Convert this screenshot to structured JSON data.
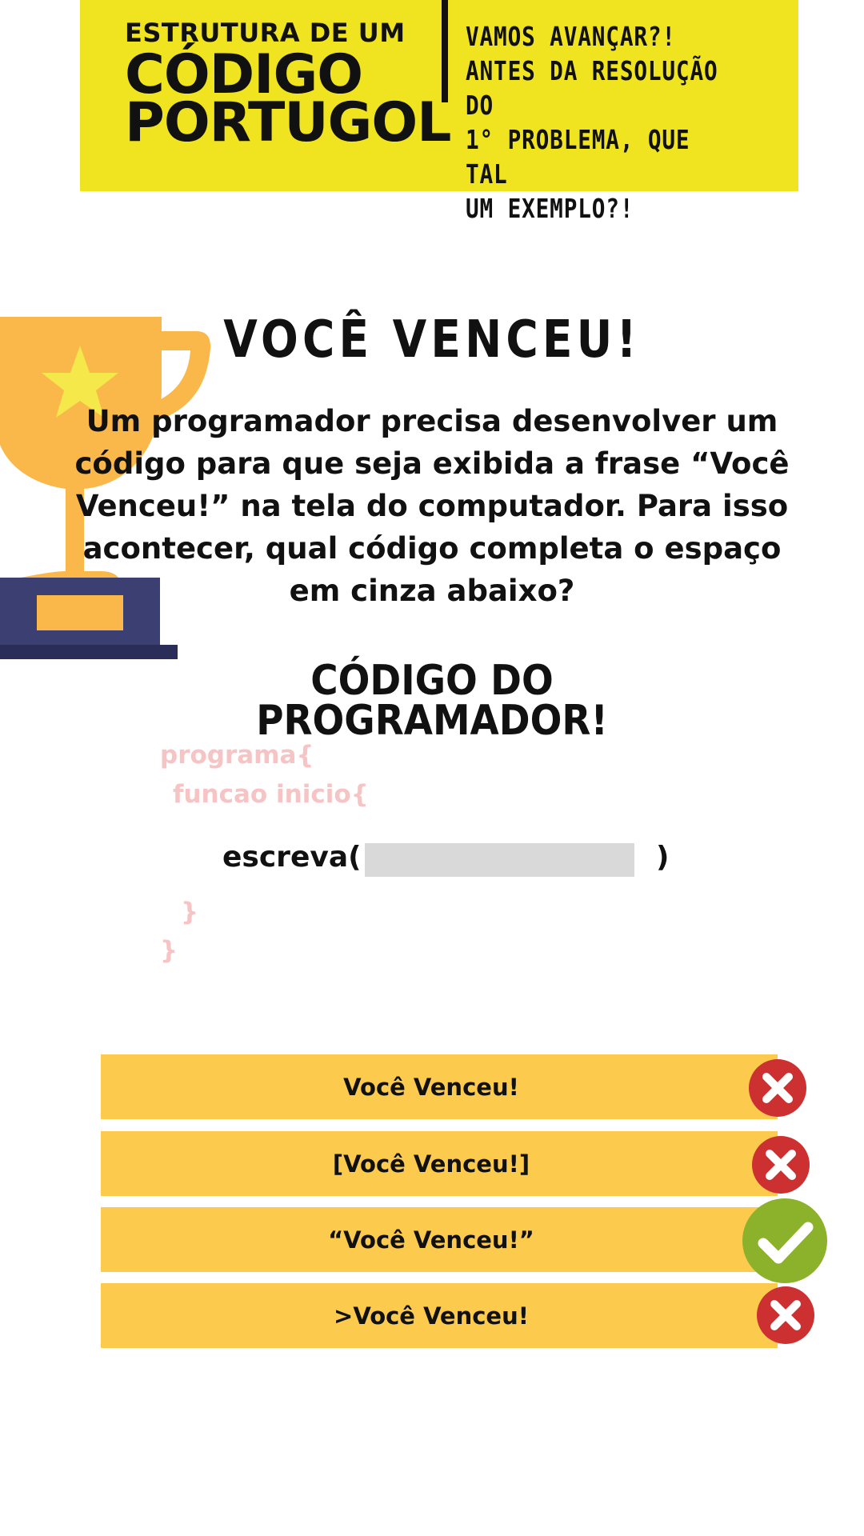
{
  "banner": {
    "kicker": "ESTRUTURA DE UM",
    "title": "CÓDIGO\nPORTUGOL",
    "side_text": "VAMOS AVANÇAR?!\nANTES DA RESOLUÇÃO DO\n1° PROBLEMA, QUE TAL\nUM EXEMPLO?!",
    "color": "#efe41f"
  },
  "trophy": {
    "icon": "trophy-icon",
    "cup_color": "#fbb84a",
    "star_color": "#f5e84b",
    "base_color": "#3b3f72"
  },
  "challenge": {
    "title": "VOCÊ VENCEU!",
    "statement": "Um programador precisa desenvolver um código para que seja exibida a frase “Você Venceu!” na tela do computador. Para isso acontecer, qual código completa o espaço em cinza abaixo?"
  },
  "code": {
    "title": "CÓDIGO DO\nPROGRAMADOR!",
    "line1": "programa{",
    "line2": "funcao inicio{",
    "call_open": "escreva(",
    "call_close": ")",
    "close_inner": "}",
    "close_outer": "}",
    "pink_color": "#f6c4c4",
    "blank_color": "#d9d9d9"
  },
  "options": [
    {
      "label": "Você Venceu!",
      "status": "wrong",
      "icon": "close-icon"
    },
    {
      "label": "[Você Venceu!]",
      "status": "wrong",
      "icon": "close-icon"
    },
    {
      "label": "“Você Venceu!”",
      "status": "correct",
      "icon": "check-icon"
    },
    {
      "label": ">Você Venceu!",
      "status": "wrong",
      "icon": "close-icon"
    }
  ],
  "colors": {
    "option_bg": "#fcca4c",
    "wrong": "#cd3031",
    "correct": "#8bb22a"
  }
}
